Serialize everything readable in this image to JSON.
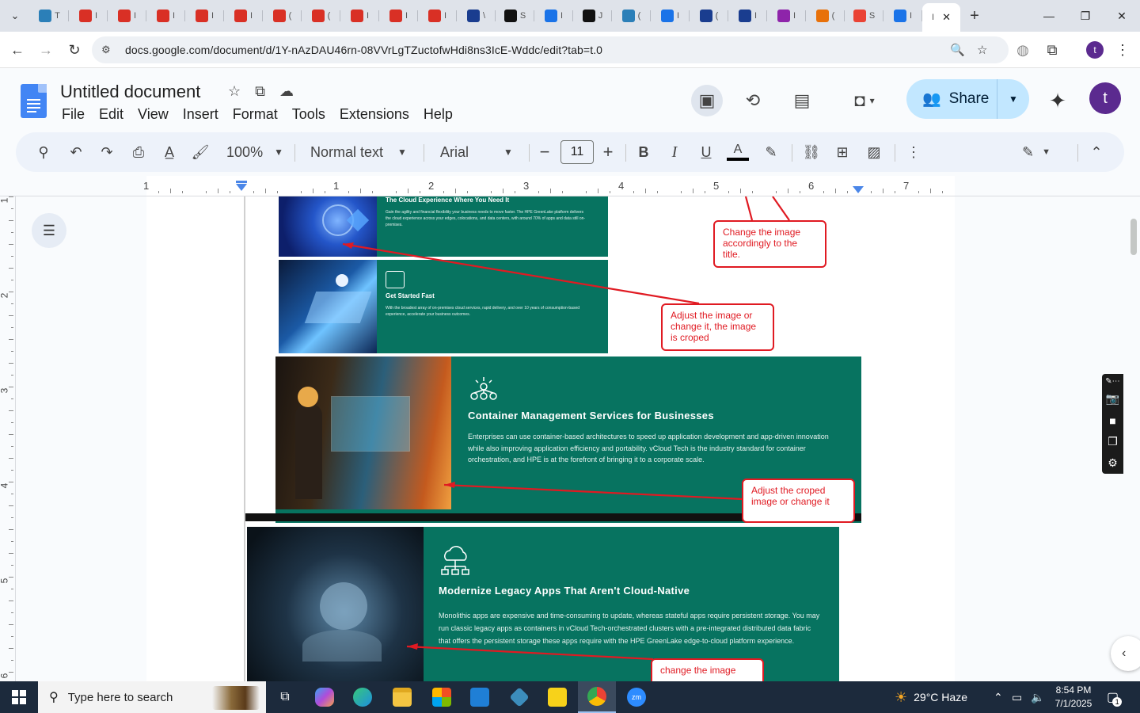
{
  "browser": {
    "tabs": [
      {
        "icon": "edge-tab-icon",
        "color": "#2b7fb8",
        "label": "T"
      },
      {
        "icon": "red-diamond-icon",
        "color": "#d93025",
        "label": "I"
      },
      {
        "icon": "red-diamond-icon",
        "color": "#d93025",
        "label": "I"
      },
      {
        "icon": "red-diamond-icon",
        "color": "#d93025",
        "label": "I"
      },
      {
        "icon": "red-diamond-icon",
        "color": "#d93025",
        "label": "I"
      },
      {
        "icon": "red-diamond-icon",
        "color": "#d93025",
        "label": "I"
      },
      {
        "icon": "red-diamond-icon",
        "color": "#d93025",
        "label": "("
      },
      {
        "icon": "red-diamond-icon",
        "color": "#d93025",
        "label": "("
      },
      {
        "icon": "red-diamond-icon",
        "color": "#d93025",
        "label": "I"
      },
      {
        "icon": "red-diamond-icon",
        "color": "#d93025",
        "label": "I"
      },
      {
        "icon": "red-diamond-icon",
        "color": "#d93025",
        "label": "I"
      },
      {
        "icon": "swoosh-icon",
        "color": "#1a3d8f",
        "label": "\\"
      },
      {
        "icon": "gear-face-icon",
        "color": "#111111",
        "label": "S"
      },
      {
        "icon": "wifi-arc-icon",
        "color": "#1a73e8",
        "label": "I"
      },
      {
        "icon": "openai-icon",
        "color": "#111111",
        "label": "J"
      },
      {
        "icon": "hex-icon",
        "color": "#2b7fb8",
        "label": "("
      },
      {
        "icon": "scales-icon",
        "color": "#1a73e8",
        "label": "I"
      },
      {
        "icon": "x-cross-icon",
        "color": "#1a3d8f",
        "label": "("
      },
      {
        "icon": "check-icon",
        "color": "#1a3d8f",
        "label": "I"
      },
      {
        "icon": "heart-icon",
        "color": "#8e24aa",
        "label": "I"
      },
      {
        "icon": "slash-icon",
        "color": "#e8710a",
        "label": "("
      },
      {
        "icon": "ring-icon",
        "color": "#ea4335",
        "label": "S"
      },
      {
        "icon": "docs-icon",
        "color": "#1a73e8",
        "label": "I"
      },
      {
        "icon": "tab-blank-icon",
        "color": "#ffffff",
        "label": "I"
      }
    ],
    "url": "docs.google.com/document/d/1Y-nAzDAU46rn-08VVrLgTZuctofwHdi8ns3IcE-Wddc/edit?tab=t.0"
  },
  "docs": {
    "title": "Untitled document",
    "menu": [
      "File",
      "Edit",
      "View",
      "Insert",
      "Format",
      "Tools",
      "Extensions",
      "Help"
    ],
    "share_label": "Share",
    "avatar_letter": "t"
  },
  "toolbar": {
    "zoom": "100%",
    "style": "Normal text",
    "font": "Arial",
    "font_size": "11",
    "text_color": "#000000"
  },
  "ruler": {
    "h_numbers": [
      "1",
      "1",
      "2",
      "3",
      "4",
      "5",
      "6",
      "7"
    ],
    "v_numbers": [
      "1",
      "2",
      "3",
      "4",
      "5",
      "6"
    ]
  },
  "content": {
    "banner1": {
      "title": "The Cloud Experience Where You Need It",
      "text": "Gain the agility and financial flexibility your business needs to move faster. The HPE GreenLake platform delivers the cloud experience across your edges, colocations, and data centers, with around 70% of apps and data still on-premises."
    },
    "banner2": {
      "title": "Get Started Fast",
      "text": "With the broadest array of on-premises cloud services, rapid delivery, and over 10 years of consumption-based experience, accelerate your business outcomes."
    },
    "banner3": {
      "title": "Container Management Services for Businesses",
      "text": "Enterprises can use container-based architectures to speed up application development and app-driven innovation while also improving application efficiency and portability. vCloud Tech is the industry standard for container orchestration, and HPE is at the forefront of bringing it to a corporate scale."
    },
    "banner4": {
      "title": "Modernize Legacy Apps That Aren't Cloud-Native",
      "text": "Monolithic apps are expensive and time-consuming to update, whereas stateful apps require persistent storage. You may run classic legacy apps as containers in vCloud Tech-orchestrated clusters with a pre-integrated distributed data fabric that offers the persistent storage these apps require with the HPE GreenLake edge-to-cloud platform experience."
    },
    "notes": {
      "n1": "Change the image accordingly to the title.",
      "n2": "Adjust the image or change it, the image is croped",
      "n3": "Adjust the croped image or change it",
      "n4": "change the image"
    }
  },
  "taskbar": {
    "search_placeholder": "Type here to search",
    "weather": "29°C  Haze",
    "time": "8:54 PM",
    "date": "7/1/2025",
    "notification_count": "1"
  }
}
